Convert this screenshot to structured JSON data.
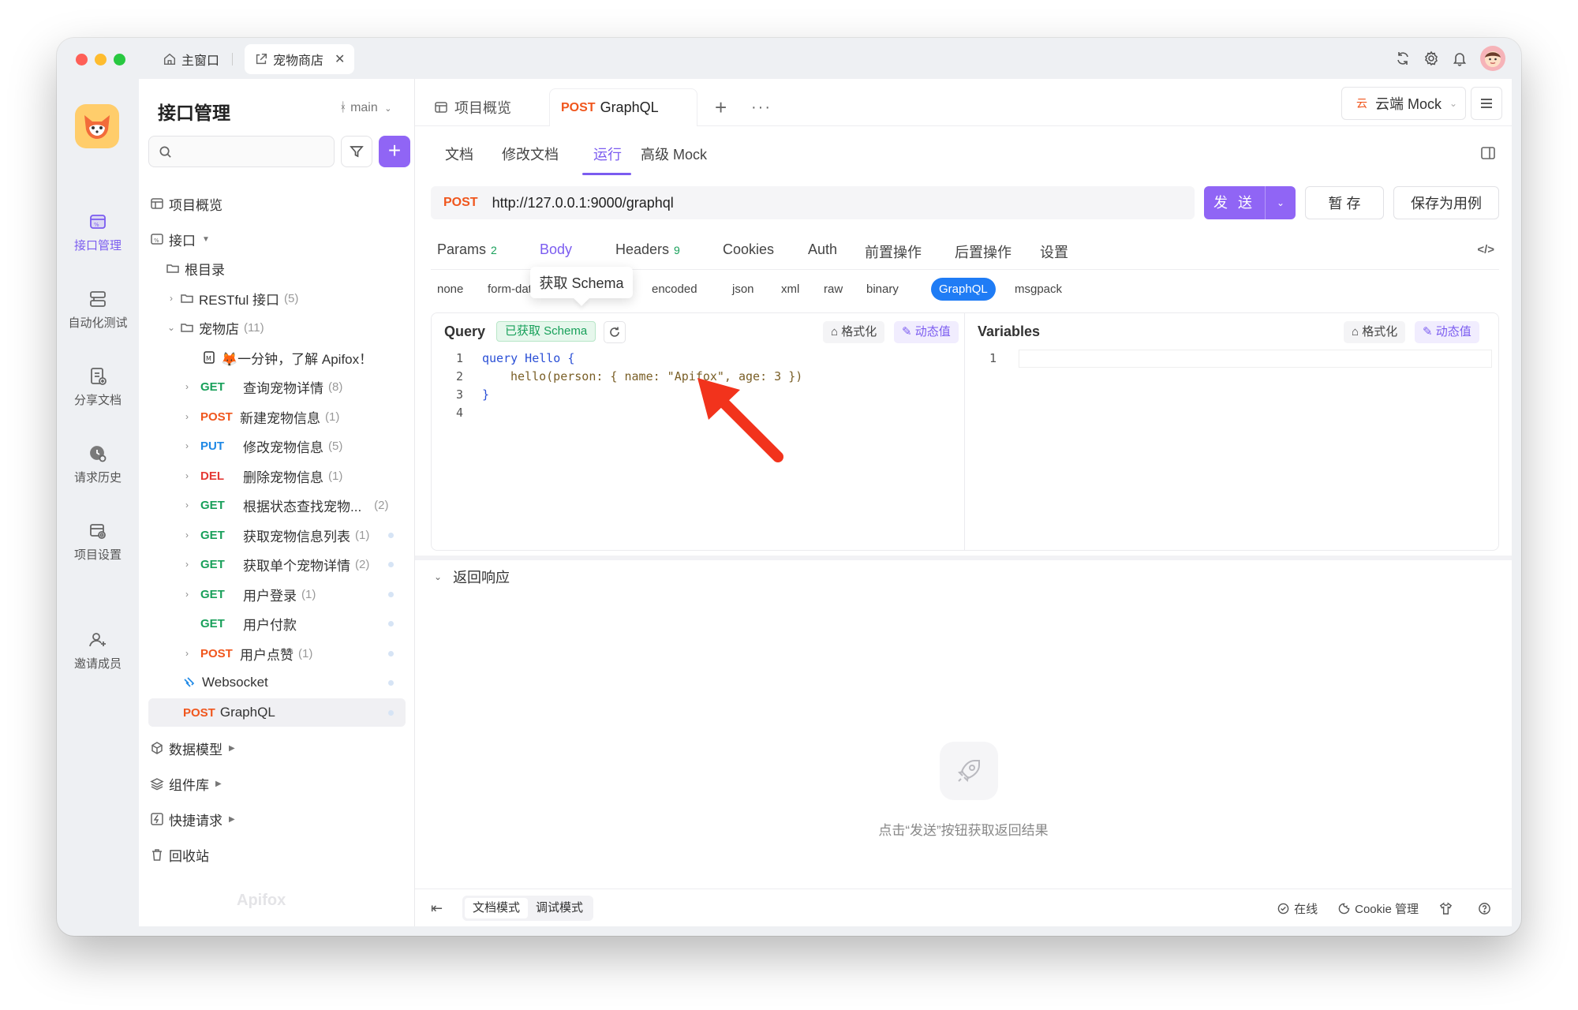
{
  "window_tabs": {
    "home": "主窗口",
    "current": "宠物商店"
  },
  "rail": {
    "items": [
      {
        "label": "接口管理",
        "icon": "api-icon",
        "active": true
      },
      {
        "label": "自动化测试",
        "icon": "automation-icon"
      },
      {
        "label": "分享文档",
        "icon": "share-doc-icon"
      },
      {
        "label": "请求历史",
        "icon": "history-icon"
      },
      {
        "label": "项目设置",
        "icon": "project-settings-icon"
      },
      {
        "label": "邀请成员",
        "icon": "invite-member-icon"
      }
    ]
  },
  "sidebar": {
    "title": "接口管理",
    "branch": "main",
    "search_placeholder": "",
    "tree": [
      {
        "label": "项目概览"
      },
      {
        "label": "接口"
      },
      {
        "label": "根目录"
      },
      {
        "label": "RESTful 接口",
        "count": "(5)"
      },
      {
        "label": "宠物店",
        "count": "(11)"
      },
      {
        "label": "🦊一分钟，了解 Apifox！"
      },
      {
        "method": "GET",
        "label": "查询宠物详情",
        "count": "(8)"
      },
      {
        "method": "POST",
        "label": "新建宠物信息",
        "count": "(1)"
      },
      {
        "method": "PUT",
        "label": "修改宠物信息",
        "count": "(5)"
      },
      {
        "method": "DEL",
        "label": "删除宠物信息",
        "count": "(1)"
      },
      {
        "method": "GET",
        "label": "根据状态查找宠物...",
        "count": "(2)"
      },
      {
        "method": "GET",
        "label": "获取宠物信息列表",
        "count": "(1)"
      },
      {
        "method": "GET",
        "label": "获取单个宠物详情",
        "count": "(2)"
      },
      {
        "method": "GET",
        "label": "用户登录",
        "count": "(1)"
      },
      {
        "method": "GET",
        "label": "用户付款"
      },
      {
        "method": "POST",
        "label": "用户点赞",
        "count": "(1)"
      },
      {
        "label": "Websocket"
      },
      {
        "method": "POST",
        "label": "GraphQL"
      },
      {
        "label": "数据模型"
      },
      {
        "label": "组件库"
      },
      {
        "label": "快捷请求"
      },
      {
        "label": "回收站"
      }
    ],
    "watermark": "Apifox"
  },
  "main": {
    "tabs": {
      "overview": "项目概览",
      "current_method": "POST",
      "current_name": "GraphQL"
    },
    "mock": {
      "icon_text": "云",
      "label": "云端 Mock"
    },
    "subtabs": [
      "文档",
      "修改文档",
      "运行",
      "高级 Mock"
    ],
    "active_subtab": "运行",
    "request": {
      "method": "POST",
      "url": "http://127.0.0.1:9000/graphql",
      "send": "发 送",
      "save": "暂 存",
      "save_case": "保存为用例"
    },
    "req_tabs": [
      {
        "label": "Params",
        "badge": "2"
      },
      {
        "label": "Body"
      },
      {
        "label": "Headers",
        "badge": "9"
      },
      {
        "label": "Cookies"
      },
      {
        "label": "Auth"
      },
      {
        "label": "前置操作"
      },
      {
        "label": "后置操作"
      },
      {
        "label": "设置"
      }
    ],
    "active_req_tab": "Body",
    "body_types": [
      "none",
      "form-data",
      "x-www-form-urlencoded",
      "json",
      "xml",
      "raw",
      "binary",
      "GraphQL",
      "msgpack"
    ],
    "body_types_visible": {
      "urlencoded_partial": "encoded"
    },
    "active_body_type": "GraphQL",
    "tooltip": "获取 Schema",
    "query": {
      "title": "Query",
      "schema_badge": "已获取 Schema",
      "format": "格式化",
      "dynamic": "动态值",
      "lines": [
        {
          "n": "1",
          "parts": [
            "query Hello {"
          ]
        },
        {
          "n": "2",
          "parts": [
            "hello(person: { name: \"Apifox\", age: 3 })"
          ]
        },
        {
          "n": "3",
          "parts": [
            "}"
          ]
        },
        {
          "n": "4",
          "parts": [
            ""
          ]
        }
      ]
    },
    "variables": {
      "title": "Variables",
      "format": "格式化",
      "dynamic": "动态值",
      "lines": [
        {
          "n": "1"
        }
      ]
    },
    "response": {
      "title": "返回响应",
      "empty": "点击“发送”按钮获取返回结果"
    },
    "footer": {
      "modes": [
        "文档模式",
        "调试模式"
      ],
      "active_mode": "文档模式",
      "online": "在线",
      "cookie": "Cookie 管理"
    }
  },
  "colors": {
    "accent": "#9065f5",
    "get": "#18a05a",
    "post": "#f0561d",
    "put": "#1e88e5",
    "del": "#e53935",
    "graphql_pill": "#1f7cf5",
    "annotation_arrow": "#f2331c"
  }
}
